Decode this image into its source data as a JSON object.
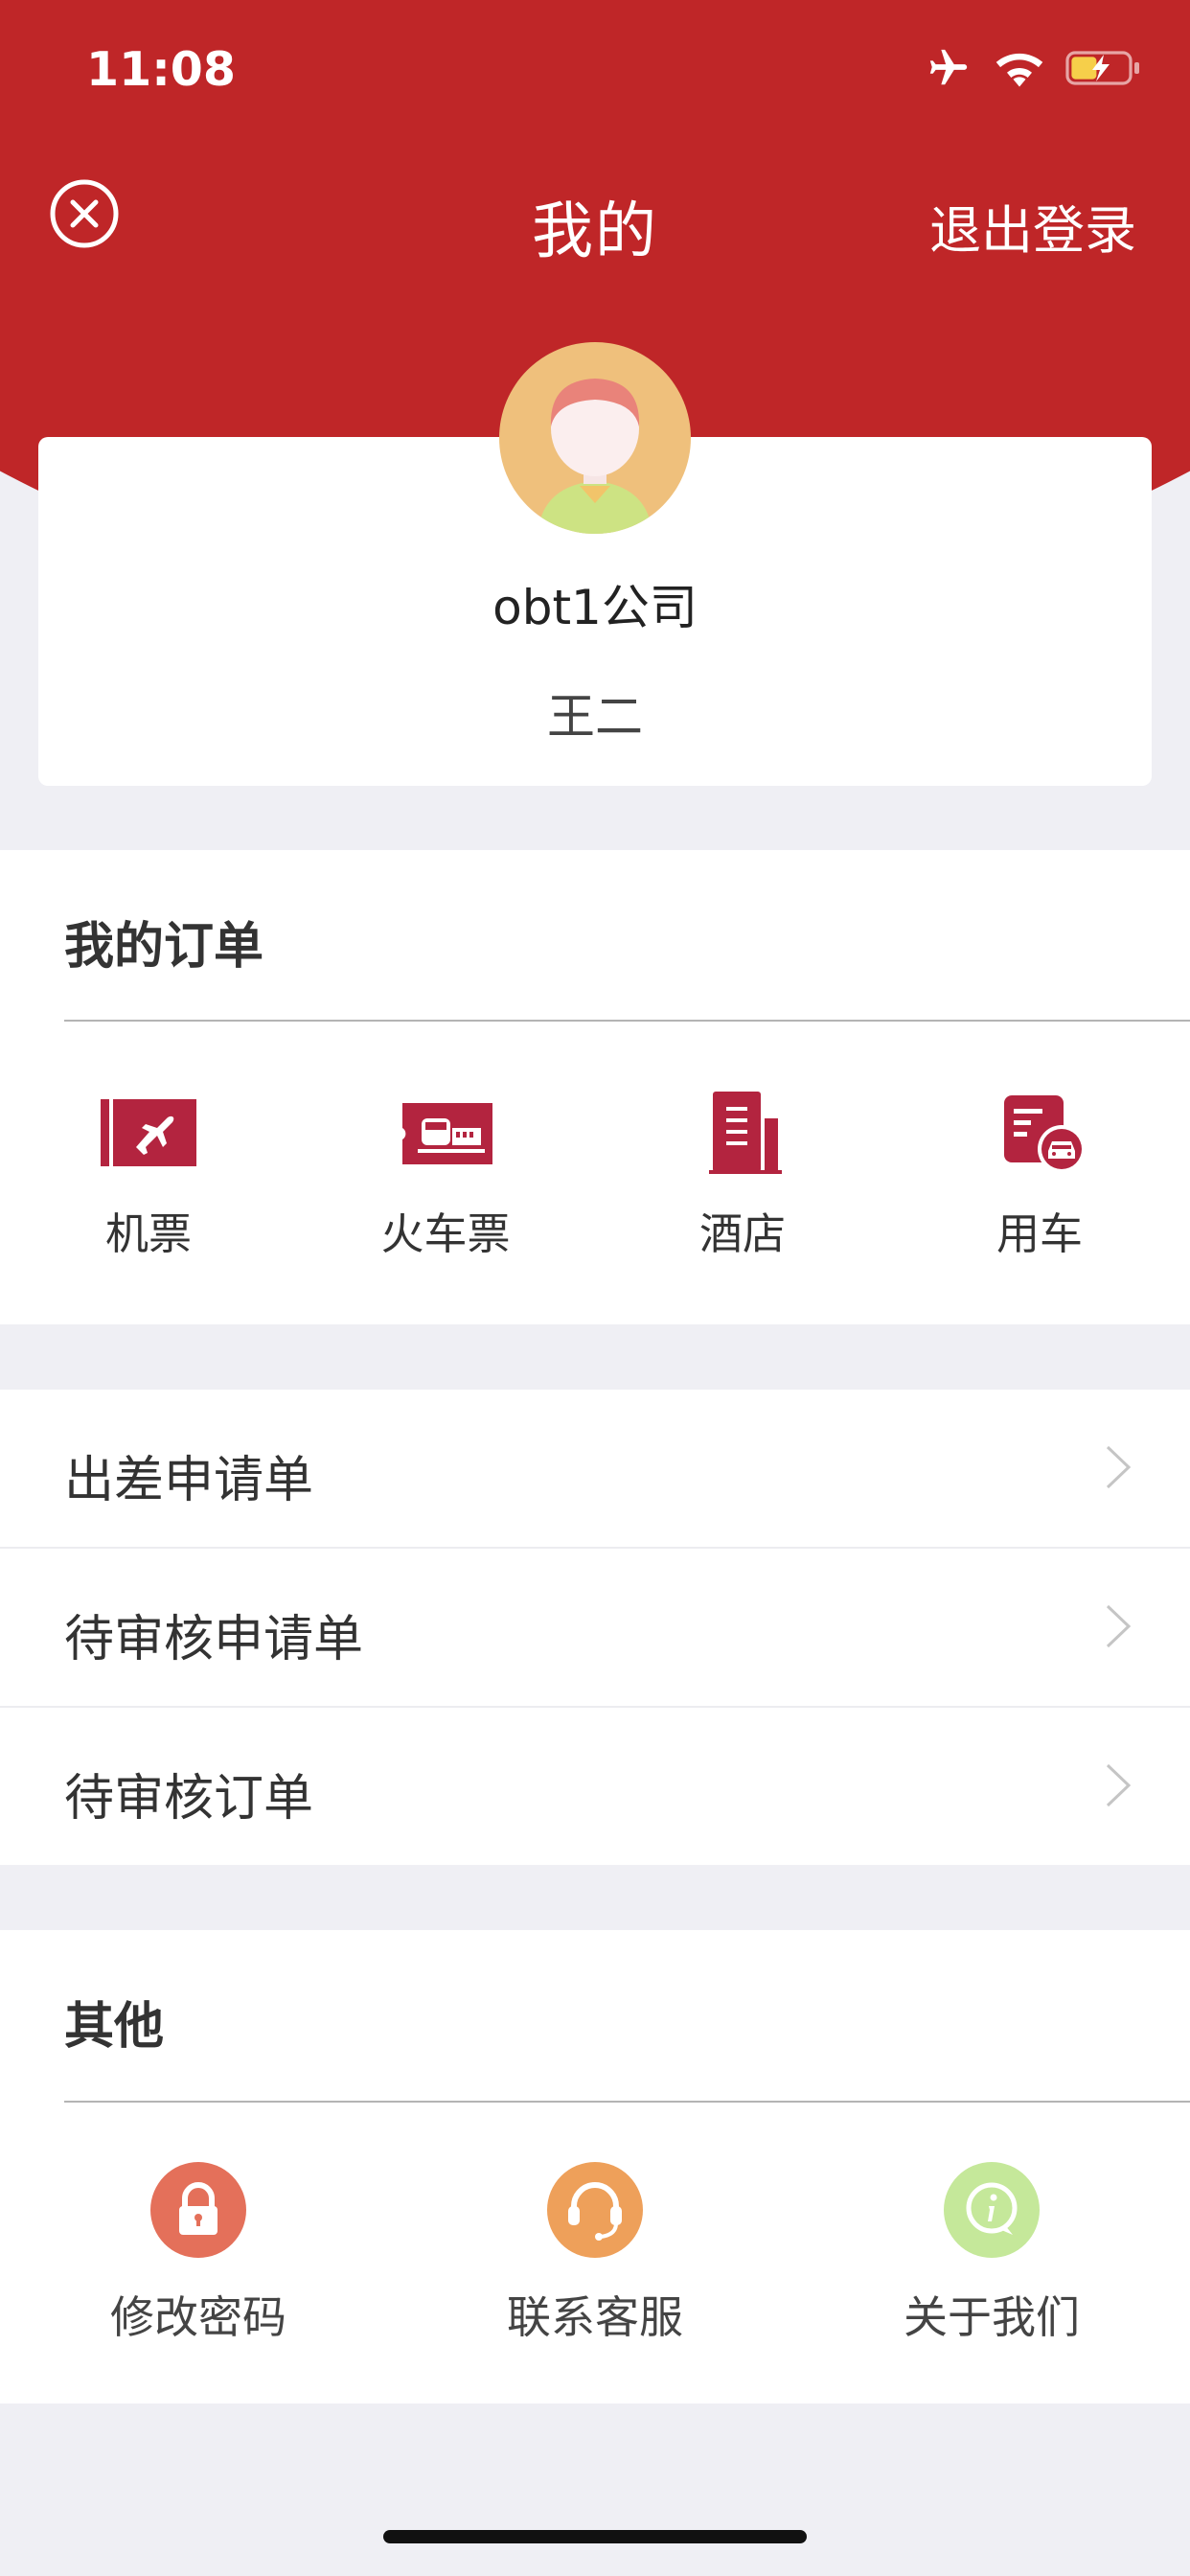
{
  "status_bar": {
    "time": "11:08"
  },
  "nav": {
    "title": "我的",
    "logout": "退出登录"
  },
  "profile": {
    "company": "obt1公司",
    "name": "王二"
  },
  "orders": {
    "title": "我的订单",
    "items": [
      {
        "label": "机票",
        "icon": "plane-ticket-icon"
      },
      {
        "label": "火车票",
        "icon": "train-ticket-icon"
      },
      {
        "label": "酒店",
        "icon": "hotel-icon"
      },
      {
        "label": "用车",
        "icon": "car-icon"
      }
    ]
  },
  "menu": {
    "items": [
      {
        "label": "出差申请单"
      },
      {
        "label": "待审核申请单"
      },
      {
        "label": "待审核订单"
      }
    ]
  },
  "other": {
    "title": "其他",
    "items": [
      {
        "label": "修改密码",
        "icon": "lock-icon",
        "color": "#e4705a"
      },
      {
        "label": "联系客服",
        "icon": "headset-icon",
        "color": "#eea05a"
      },
      {
        "label": "关于我们",
        "icon": "info-icon",
        "color": "#c5e89a"
      }
    ]
  },
  "colors": {
    "brand": "#bf2628",
    "order_icon": "#b3243f"
  }
}
